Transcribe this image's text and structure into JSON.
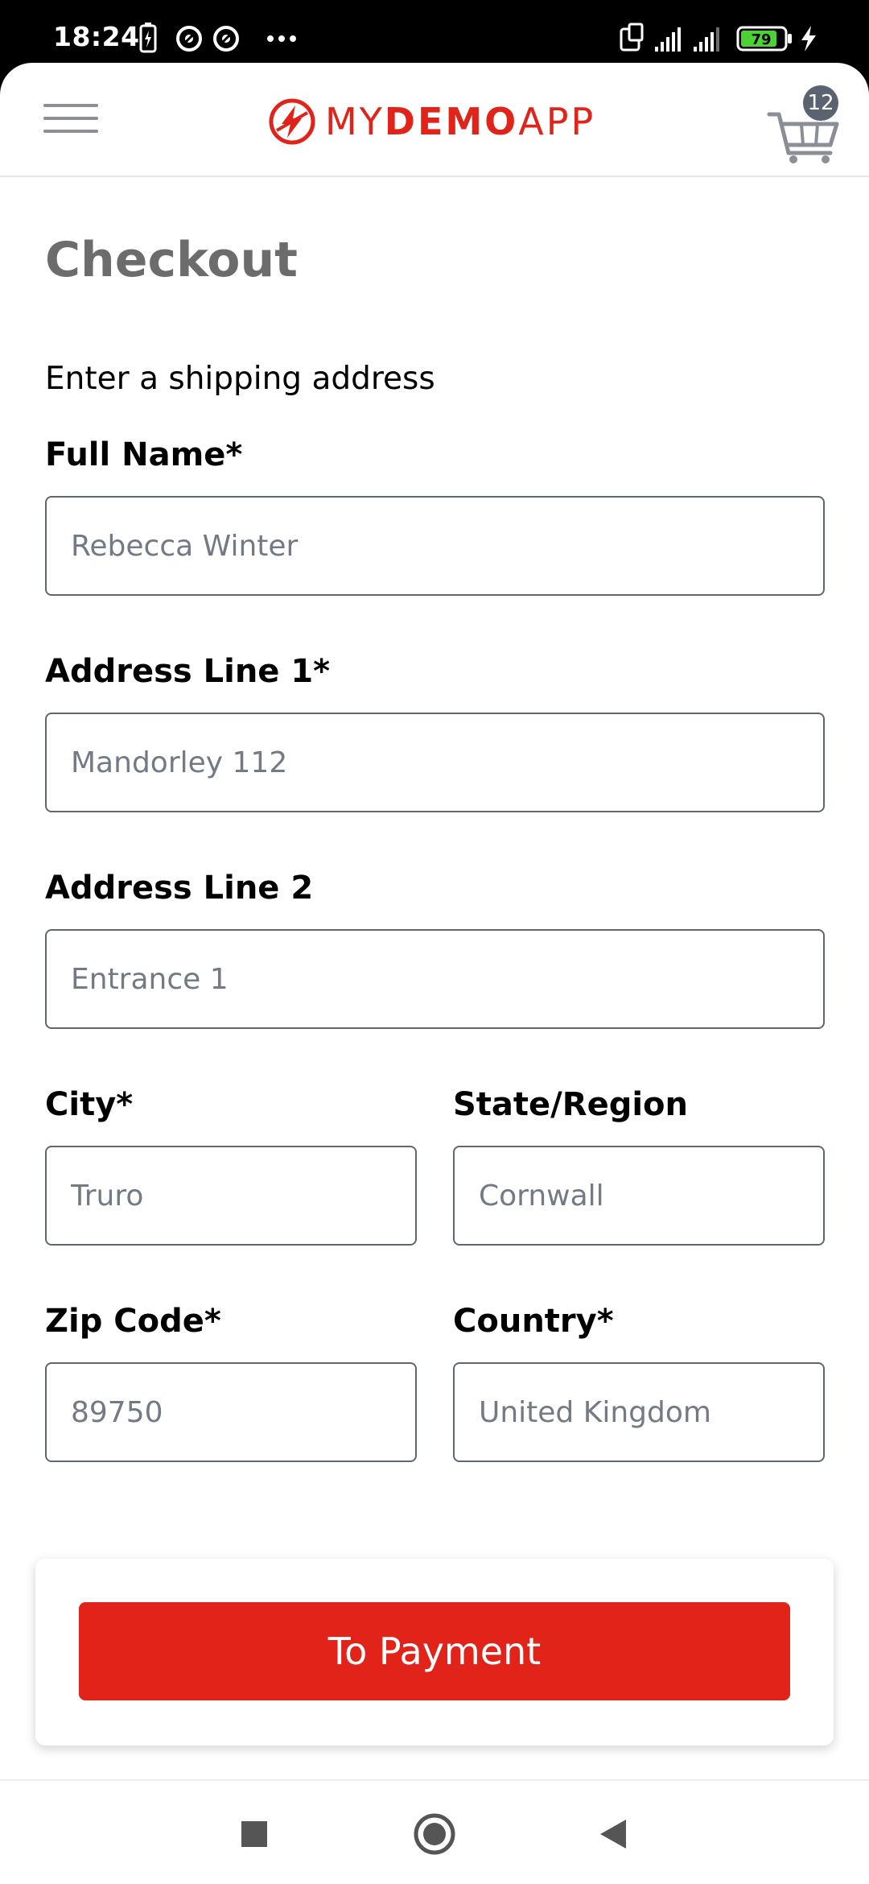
{
  "status_bar": {
    "time": "18:24",
    "left_icons": [
      "battery-saver-icon",
      "vpn-icon",
      "vpn-icon",
      "more-dots-icon"
    ],
    "right_icons": [
      "screen-rotate-icon",
      "signal-icon",
      "signal-icon",
      "battery-icon",
      "charging-icon"
    ],
    "battery_level": "79"
  },
  "header": {
    "logo_text_light_1": "MY",
    "logo_text_bold": "DEMO",
    "logo_text_light_2": "APP",
    "cart_count": "12",
    "brand_color": "#e2231a"
  },
  "checkout": {
    "title": "Checkout",
    "section_title": "Enter a shipping address",
    "fields": {
      "full_name": {
        "label": "Full Name*",
        "value": "Rebecca Winter"
      },
      "address_line_1": {
        "label": "Address Line 1*",
        "value": "Mandorley 112"
      },
      "address_line_2": {
        "label": "Address Line 2",
        "value": "Entrance 1"
      },
      "city": {
        "label": "City*",
        "value": "Truro"
      },
      "state_region": {
        "label": "State/Region",
        "value": "Cornwall"
      },
      "zip_code": {
        "label": "Zip Code*",
        "value": "89750"
      },
      "country": {
        "label": "Country*",
        "value": "United Kingdom"
      }
    },
    "submit_label": "To Payment"
  },
  "nav_bar": {
    "icons": [
      "recents-square-icon",
      "home-circle-icon",
      "back-triangle-icon"
    ]
  }
}
